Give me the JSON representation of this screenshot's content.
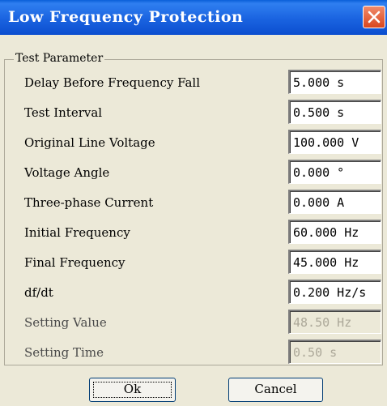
{
  "window": {
    "title": "Low Frequency Protection"
  },
  "group": {
    "legend": "Test Parameter"
  },
  "rows": [
    {
      "label": "Delay Before Frequency Fall",
      "value": "5.000 s"
    },
    {
      "label": "Test Interval",
      "value": "0.500 s"
    },
    {
      "label": "Original Line Voltage",
      "value": "100.000 V"
    },
    {
      "label": "Voltage Angle",
      "value": "0.000 °"
    },
    {
      "label": "Three-phase Current",
      "value": "0.000 A"
    },
    {
      "label": "Initial Frequency",
      "value": "60.000 Hz"
    },
    {
      "label": "Final Frequency",
      "value": "45.000 Hz"
    },
    {
      "label": "df/dt",
      "value": "0.200 Hz/s"
    },
    {
      "label": "Setting Value",
      "value": "48.50 Hz"
    },
    {
      "label": "Setting Time",
      "value": "0.50 s"
    }
  ],
  "buttons": {
    "ok": "Ok",
    "cancel": "Cancel"
  }
}
